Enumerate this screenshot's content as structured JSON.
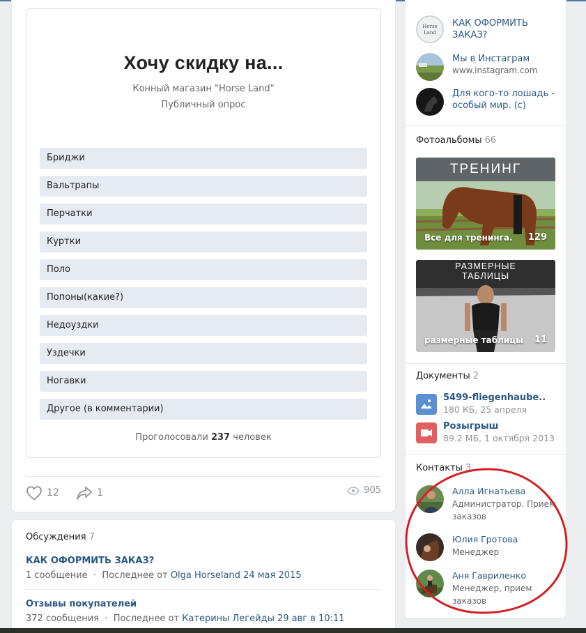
{
  "poll": {
    "title": "Хочу скидку на...",
    "author": "Конный магазин \"Horse Land\"",
    "type": "Публичный опрос",
    "options": [
      "Бриджи",
      "Вальтрапы",
      "Перчатки",
      "Куртки",
      "Поло",
      "Попоны(какие?)",
      "Недоуздки",
      "Уздечки",
      "Ногавки",
      "Другое (в комментарии)"
    ],
    "total_prefix": "Проголосовали",
    "total_count": "237",
    "total_suffix": "человек"
  },
  "post_actions": {
    "likes": "12",
    "shares": "1",
    "views": "905"
  },
  "discussions": {
    "title": "Обсуждения",
    "count": "7",
    "topics": [
      {
        "title": "КАК ОФОРМИТЬ ЗАКАЗ?",
        "messages": "1 сообщение",
        "last_prefix": "Последнее от",
        "last_author": "Olga Horseland",
        "last_date": "24 мая 2015"
      },
      {
        "title": "Отзывы покупателей",
        "messages": "372 сообщения",
        "last_prefix": "Последнее от",
        "last_author": "Катерины Легейды",
        "last_date": "29 авг в 10:11"
      }
    ]
  },
  "links": [
    {
      "name": "КАК ОФОРМИТЬ ЗАКАЗ?",
      "sub": ""
    },
    {
      "name": "Мы в Инстаграм",
      "sub": "www.instagram.com"
    },
    {
      "name": "Для кого-то лошадь - особый мир. (с)",
      "sub": ""
    }
  ],
  "albums": {
    "title": "Фотоальбомы",
    "count": "66",
    "items": [
      {
        "banner": "ТРЕНИНГ",
        "label": "Все для тренинга.",
        "count": "129"
      },
      {
        "banner_line1": "РАЗМЕРНЫЕ",
        "banner_line2": "ТАБЛИЦЫ",
        "label": "размерные таблицы",
        "count": "11"
      }
    ]
  },
  "documents": {
    "title": "Документы",
    "count": "2",
    "items": [
      {
        "name": "5499-fliegenhaube..",
        "meta": "180 КБ, 25 апреля",
        "icon": "image-doc-icon",
        "color": "#5b8fd1"
      },
      {
        "name": "Розыгрыш",
        "meta": "89.2 МБ, 1 октября 2013",
        "icon": "video-doc-icon",
        "color": "#e25f5f"
      }
    ]
  },
  "contacts": {
    "title": "Контакты",
    "count": "3",
    "items": [
      {
        "name": "Алла Игнатьева",
        "role": "Администратор. Прием заказов"
      },
      {
        "name": "Юлия Гротова",
        "role": "Менеджер"
      },
      {
        "name": "Аня Гавриленко",
        "role": "Менеджер, прием заказов"
      }
    ]
  },
  "colors": {
    "link": "#2a5885",
    "accent": "#4a76a8",
    "option_bg": "#e5ebf1",
    "annotation": "#d42024"
  }
}
